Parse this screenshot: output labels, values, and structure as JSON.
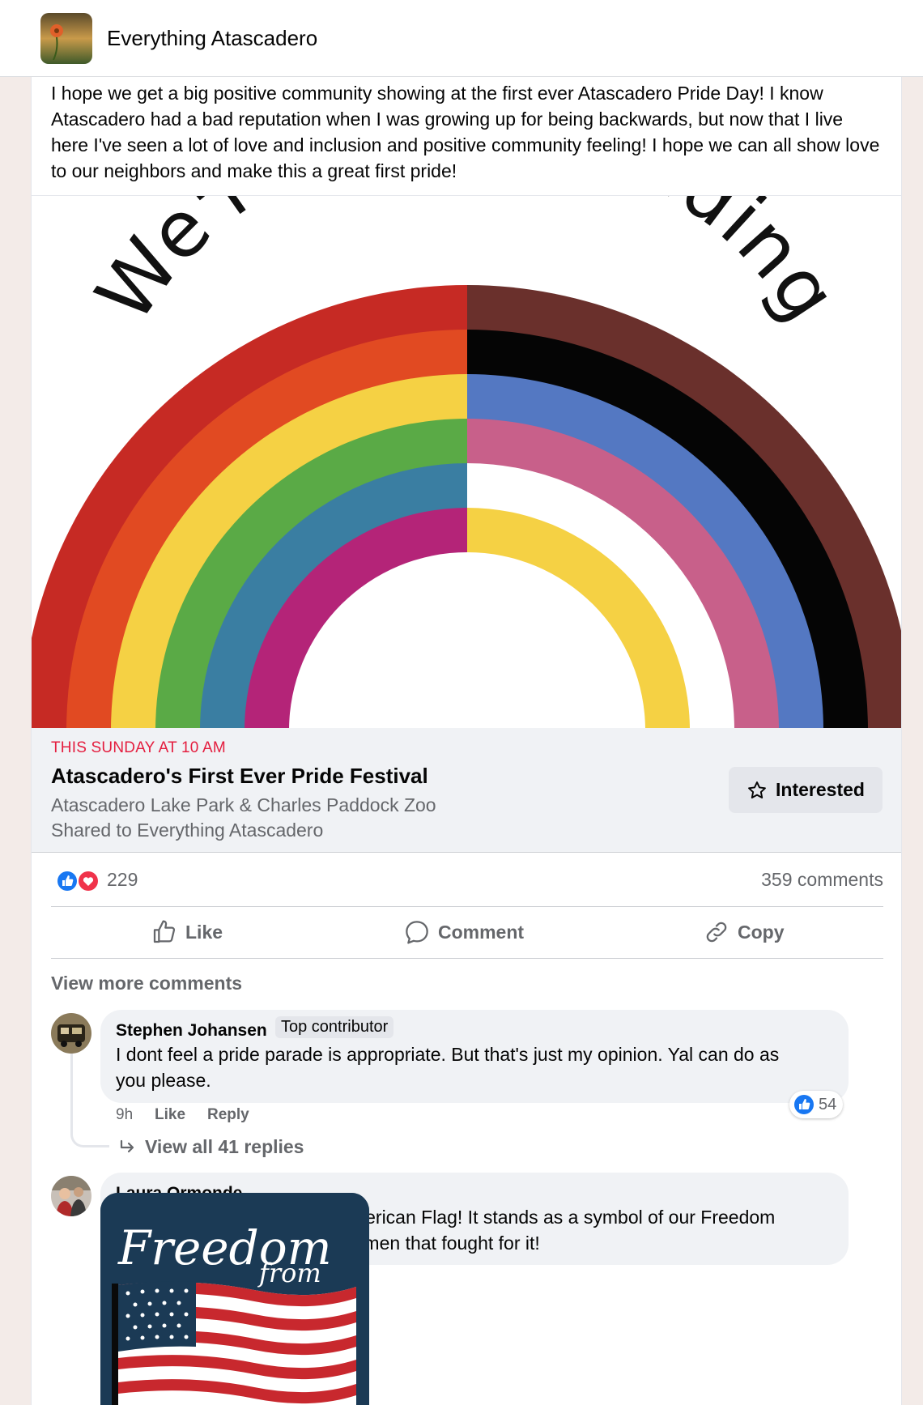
{
  "group": {
    "name": "Everything Atascadero"
  },
  "post": {
    "text": "I hope we get a big positive community showing at the first ever Atascadero Pride Day! I know Atascadero had a bad reputation when I was growing up for being backwards, but now that I live here I've seen a lot of love and inclusion and positive community feeling! I hope we can all show love to our neighbors and make this a great first pride!"
  },
  "event": {
    "image_text": "We're Still Standing",
    "date": "THIS SUNDAY AT 10 AM",
    "title": "Atascadero's First Ever Pride Festival",
    "location": "Atascadero Lake Park & Charles Paddock Zoo",
    "shared": "Shared to Everything Atascadero",
    "interested_label": "Interested"
  },
  "stats": {
    "reactions": "229",
    "comments": "359 comments"
  },
  "actions": {
    "like": "Like",
    "comment": "Comment",
    "copy": "Copy"
  },
  "view_more_comments": "View more comments",
  "comments": [
    {
      "author": "Stephen Johansen",
      "badge": "Top contributor",
      "text_line1": "I dont feel a pride parade is appropriate. But that's just my opinion. Yal can do as",
      "text_line2": "you please.",
      "time": "9h",
      "like": "Like",
      "reply": "Reply",
      "like_count": "54",
      "replies": "View all 41 replies"
    },
    {
      "author": "Laura Ormonde",
      "text_line1": "How about celebrating our American Flag! It stands as a symbol of our Freedom",
      "text_line2": "and all the brave Men and Women that fought for it!",
      "image_text_1": "Freedom",
      "image_text_2": "from"
    }
  ],
  "colors": {
    "accent_blue": "#1877f2",
    "event_date_red": "#e41e3f",
    "secondary_text": "#65676b",
    "bubble_bg": "#f0f2f5"
  }
}
